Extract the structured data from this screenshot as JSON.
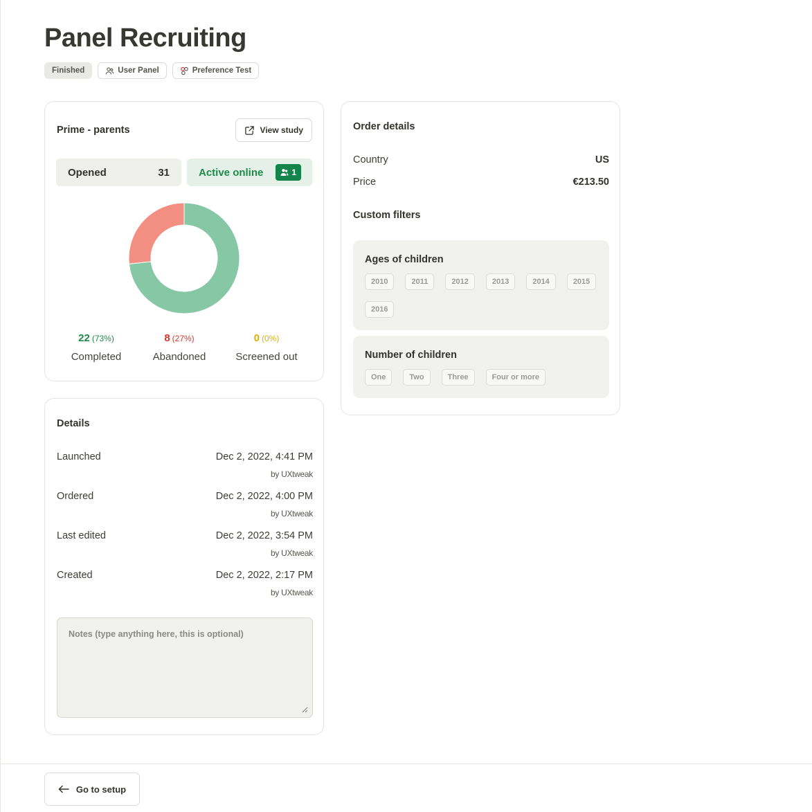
{
  "page": {
    "title": "Panel Recruiting",
    "tags": [
      {
        "label": "Finished",
        "icon": "none"
      },
      {
        "label": "User Panel",
        "icon": "users-icon"
      },
      {
        "label": "Preference Test",
        "icon": "preference-icon"
      }
    ]
  },
  "study": {
    "name": "Prime - parents",
    "view_label": "View study",
    "opened_label": "Opened",
    "opened_value": "31",
    "active_label": "Active online",
    "active_value": "1"
  },
  "chart_data": {
    "type": "pie",
    "categories": [
      "Completed",
      "Abandoned",
      "Screened out"
    ],
    "values": [
      22,
      8,
      0
    ],
    "percent_labels": [
      "(73%)",
      "(27%)",
      "(0%)"
    ],
    "colors": [
      "#86c7a5",
      "#f28f82",
      "#f2c94c"
    ],
    "text_colors": [
      "#1d8a4a",
      "#d9362b",
      "#e0b000"
    ],
    "title": "",
    "xlabel": "",
    "ylabel": ""
  },
  "details": {
    "title": "Details",
    "rows": [
      {
        "label": "Launched",
        "value": "Dec 2, 2022, 4:41 PM",
        "by": "by UXtweak"
      },
      {
        "label": "Ordered",
        "value": "Dec 2, 2022, 4:00 PM",
        "by": "by UXtweak"
      },
      {
        "label": "Last edited",
        "value": "Dec 2, 2022, 3:54 PM",
        "by": "by UXtweak"
      },
      {
        "label": "Created",
        "value": "Dec 2, 2022, 2:17 PM",
        "by": "by UXtweak"
      }
    ],
    "notes_placeholder": "Notes (type anything here, this is optional)"
  },
  "order": {
    "title": "Order details",
    "country_label": "Country",
    "country_value": "US",
    "price_label": "Price",
    "price_value": "€213.50",
    "filters_title": "Custom filters",
    "filters": [
      {
        "name": "Ages of children",
        "options": [
          "2010",
          "2011",
          "2012",
          "2013",
          "2014",
          "2015",
          "2016"
        ]
      },
      {
        "name": "Number of children",
        "options": [
          "One",
          "Two",
          "Three",
          "Four or more"
        ]
      }
    ]
  },
  "footer": {
    "back_label": "Go to setup"
  },
  "colors": {
    "accent_green": "#13844a",
    "text_dark": "#33332e"
  }
}
